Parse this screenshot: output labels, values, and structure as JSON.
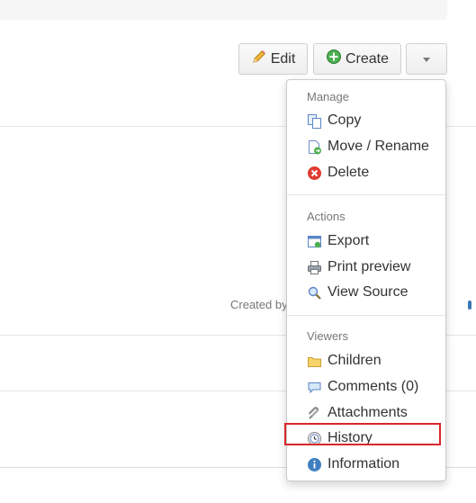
{
  "toolbar": {
    "edit_label": "Edit",
    "create_label": "Create"
  },
  "page": {
    "created_by_text": "Created by"
  },
  "menu": {
    "sections": [
      {
        "header": "Manage",
        "items": [
          {
            "label": "Copy",
            "icon": "copy-icon"
          },
          {
            "label": "Move / Rename",
            "icon": "move-rename-icon"
          },
          {
            "label": "Delete",
            "icon": "delete-icon"
          }
        ]
      },
      {
        "header": "Actions",
        "items": [
          {
            "label": "Export",
            "icon": "export-icon"
          },
          {
            "label": "Print preview",
            "icon": "printer-icon"
          },
          {
            "label": "View Source",
            "icon": "magnifier-icon"
          }
        ]
      },
      {
        "header": "Viewers",
        "items": [
          {
            "label": "Children",
            "icon": "folder-icon"
          },
          {
            "label": "Comments (0)",
            "icon": "comment-icon"
          },
          {
            "label": "Attachments",
            "icon": "paperclip-icon"
          },
          {
            "label": "History",
            "icon": "history-clock-icon"
          },
          {
            "label": "Information",
            "icon": "info-icon"
          }
        ]
      }
    ],
    "highlighted_item": "History"
  },
  "colors": {
    "highlight_border": "#d9252a",
    "delete_red": "#e03b2f",
    "create_green": "#4caf50",
    "info_blue": "#3f7fc0"
  }
}
